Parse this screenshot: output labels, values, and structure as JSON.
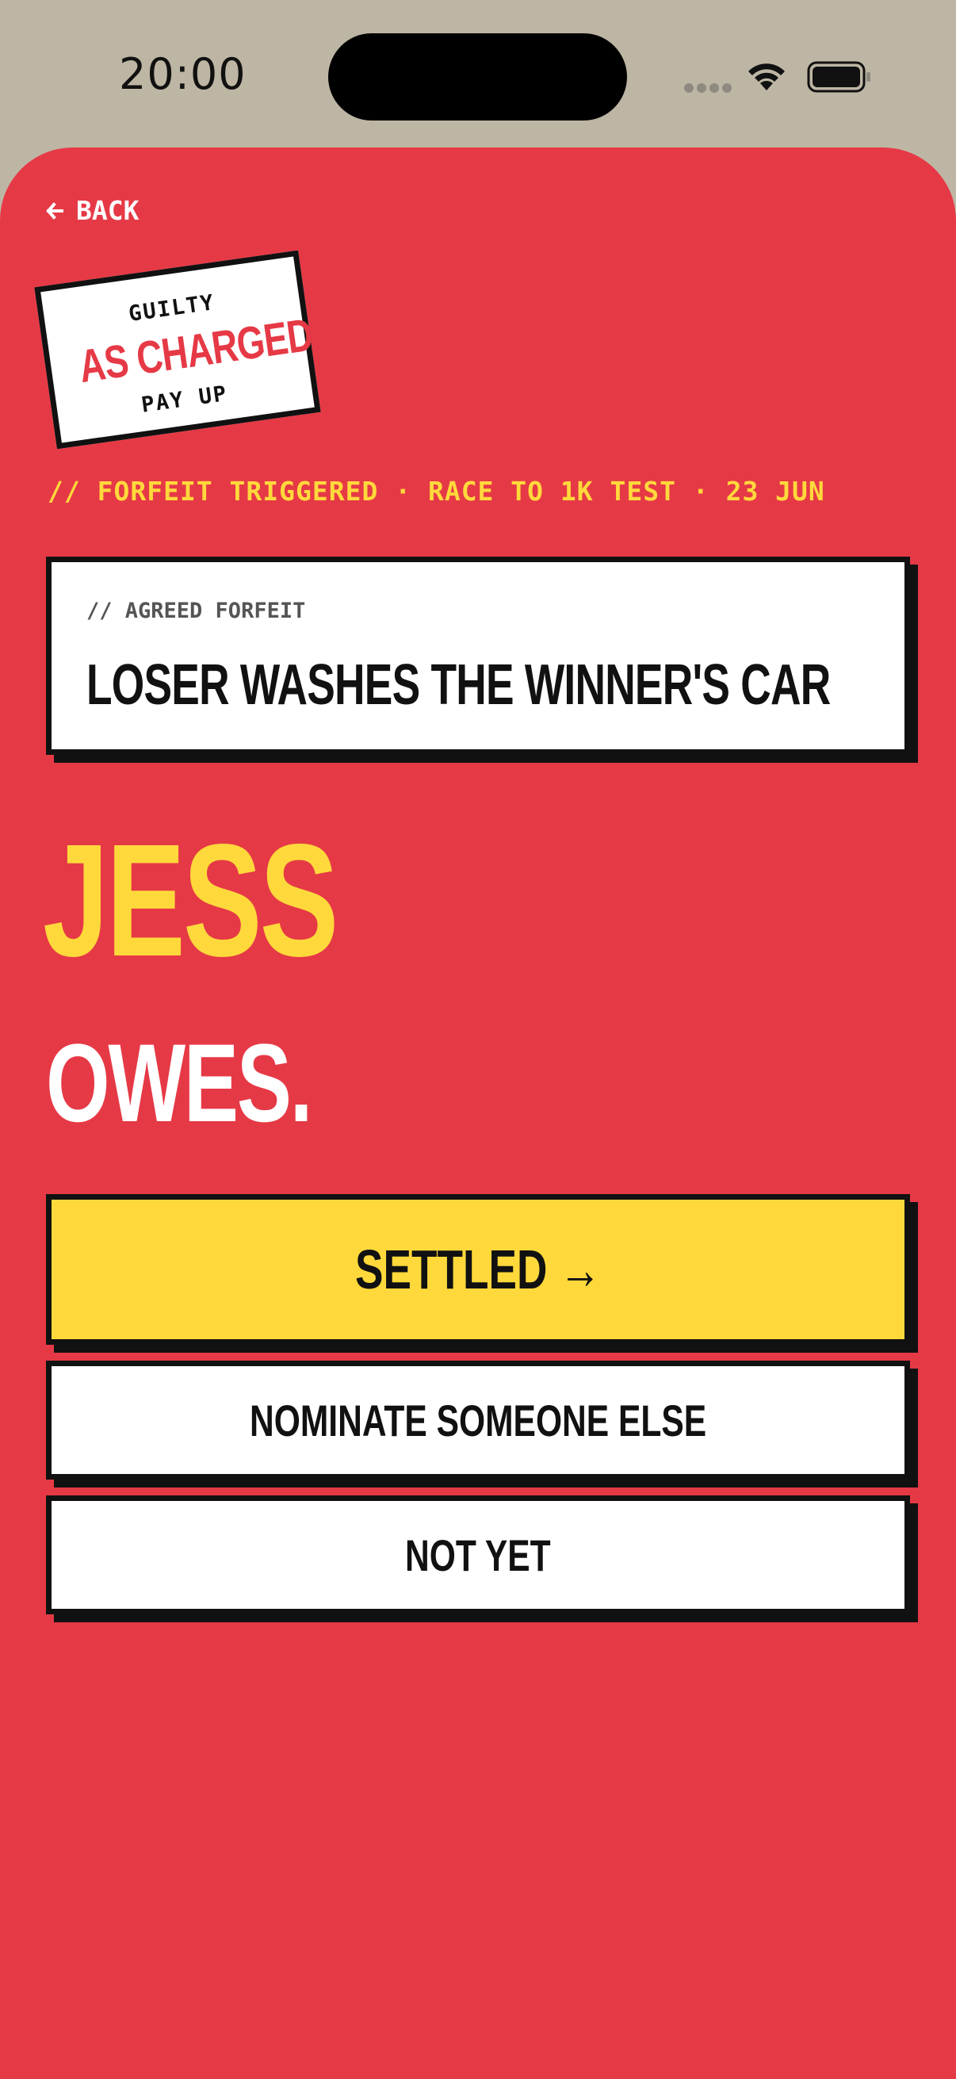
{
  "status_bar": {
    "time": "20:00"
  },
  "nav": {
    "back_label": "BACK"
  },
  "stamp": {
    "top": "GUILTY",
    "main": "AS CHARGED",
    "bottom": "PAY UP"
  },
  "meta_line": "// FORFEIT TRIGGERED · RACE TO 1K TEST · 23 JUN",
  "forfeit_card": {
    "label": "// AGREED FORFEIT",
    "title": "LOSER WASHES THE WINNER'S CAR"
  },
  "verdict": {
    "name": "JESS",
    "owes": "OWES."
  },
  "actions": {
    "settled": "SETTLED →",
    "nominate": "NOMINATE SOMEONE ELSE",
    "not_yet": "NOT YET"
  },
  "colors": {
    "background": "#E63946",
    "accent": "#FFD93B",
    "frame": "#BEB6A4",
    "ink": "#111111"
  }
}
